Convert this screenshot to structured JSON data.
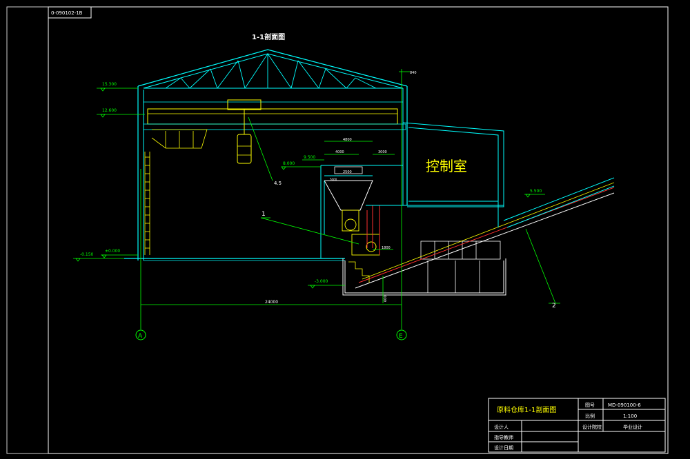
{
  "colors": {
    "frame": "#ffffff",
    "cyan": "#00ffff",
    "green": "#00ff00",
    "yellow": "#ffff00",
    "red": "#ff3030",
    "magenta": "#ff00ff"
  },
  "corner_tag": "0-090102-1B",
  "drawing": {
    "section_title": "1-1剖面图",
    "control_room": "控制室",
    "dims": {
      "d_840": "840",
      "d_4800": "4800",
      "d_4000": "4000",
      "d_5000": "5000",
      "d_3000": "3000",
      "d_2500": "2500",
      "d_1800": "1800",
      "d_600": "600",
      "span_24000": "24000"
    },
    "elevations": {
      "e_15300": "15.300",
      "e_12600": "12.600",
      "e_9500": "9.500",
      "e_8000": "8.000",
      "e_5500": "5.500",
      "e_neg0150": "-0.150",
      "e_0000": "±0.000",
      "e_neg3000": "-3.000"
    },
    "crane_mark": "4.5",
    "leader_1": "1",
    "leader_2": "2",
    "axis_a": "A",
    "axis_e": "E"
  },
  "title_block": {
    "name": "原料仓库1-1剖面图",
    "drawing_no_label": "图号",
    "drawing_no": "MD-090100-6",
    "scale_label": "比例",
    "scale": "1:100",
    "designer_label": "设计人",
    "advisor_label": "指导教师",
    "date_label": "设计日期",
    "type_label": "毕业设计",
    "type_value": "毕业设计",
    "school_label": "设计院校"
  }
}
